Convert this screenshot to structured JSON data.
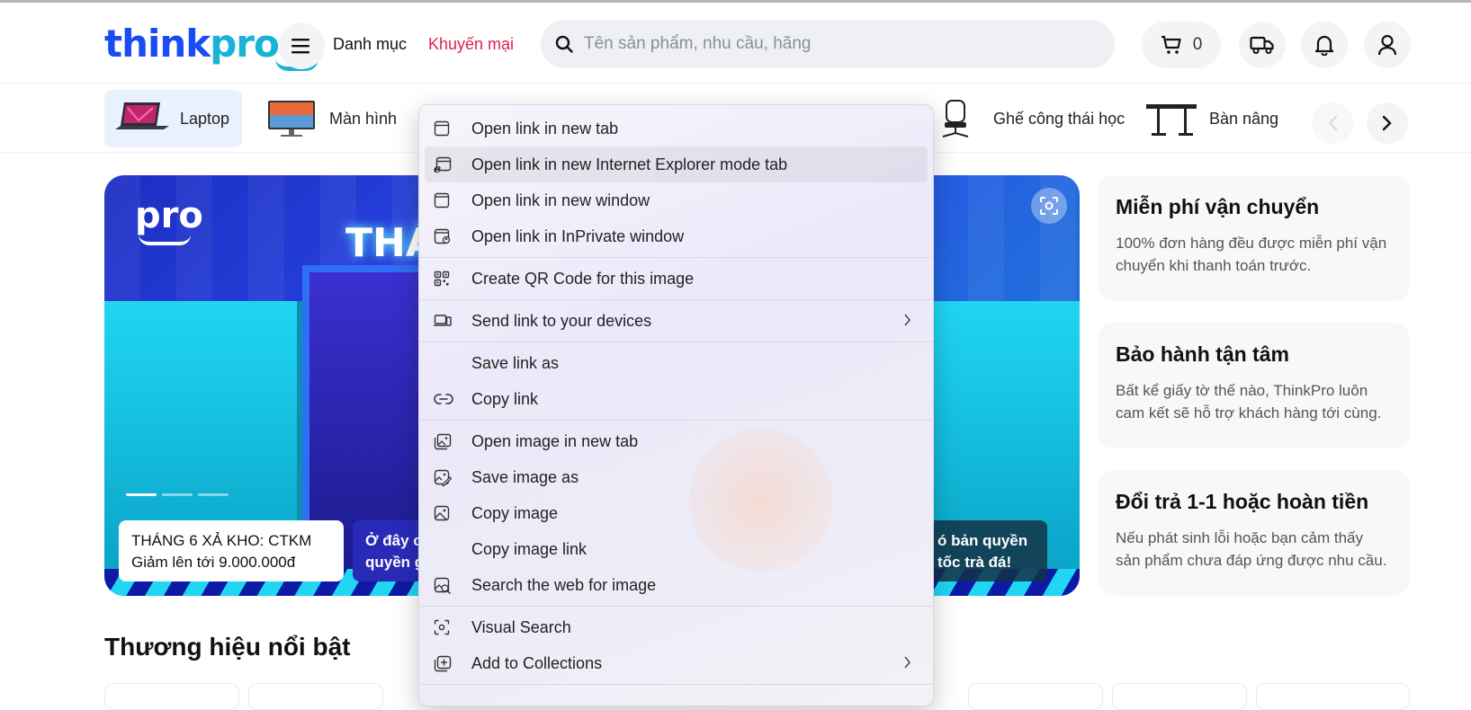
{
  "header": {
    "logo_part1": "think",
    "logo_part2": "pro",
    "menu_label": "Danh mục",
    "promo_label": "Khuyến mại",
    "search_placeholder": "Tên sản phẩm, nhu cầu, hãng",
    "cart_count": "0"
  },
  "categories": [
    {
      "label": "Laptop",
      "active": true
    },
    {
      "label": "Màn hình",
      "active": false
    },
    {
      "label": "Ghế công thái học",
      "active": false
    },
    {
      "label": "Bàn nâng",
      "active": false
    }
  ],
  "banner": {
    "logo": "pro",
    "headline": "THÁ",
    "captions": [
      {
        "line1": "THÁNG 6 XẢ KHO: CTKM",
        "line2": "Giảm lên tới 9.000.000đ"
      },
      {
        "line1": "Ở đây c",
        "line2": "quyền g"
      },
      {
        "line1": "ó bản quyền",
        "line2": "tốc trà đá!"
      }
    ]
  },
  "promos": [
    {
      "title": "Miễn phí vận chuyển",
      "text": "100% đơn hàng đều được miễn phí vận chuyển khi thanh toán trước."
    },
    {
      "title": "Bảo hành tận tâm",
      "text": "Bất kể giấy tờ thế nào, ThinkPro luôn cam kết sẽ hỗ trợ khách hàng tới cùng."
    },
    {
      "title": "Đổi trả 1-1 hoặc hoàn tiền",
      "text": "Nếu phát sinh lỗi hoặc bạn cảm thấy sản phẩm chưa đáp ứng được nhu cầu."
    }
  ],
  "brands_title": "Thương hiệu nổi bật",
  "context_menu": {
    "items": [
      {
        "label": "Open link in new tab",
        "icon": "new-tab-icon"
      },
      {
        "label": "Open link in new Internet Explorer mode tab",
        "icon": "ie-icon"
      },
      {
        "label": "Open link in new window",
        "icon": "window-icon"
      },
      {
        "label": "Open link in InPrivate window",
        "icon": "inprivate-icon"
      },
      {
        "label": "Create QR Code for this image",
        "icon": "qr-icon"
      },
      {
        "label": "Send link to your devices",
        "icon": "devices-icon"
      },
      {
        "label": "Save link as",
        "icon": ""
      },
      {
        "label": "Copy link",
        "icon": "link-icon"
      },
      {
        "label": "Open image in new tab",
        "icon": "image-tab-icon"
      },
      {
        "label": "Save image as",
        "icon": "save-image-icon"
      },
      {
        "label": "Copy image",
        "icon": "image-icon"
      },
      {
        "label": "Copy image link",
        "icon": ""
      },
      {
        "label": "Search the web for image",
        "icon": "image-search-icon"
      },
      {
        "label": "Visual Search",
        "icon": "visual-search-icon"
      },
      {
        "label": "Add to Collections",
        "icon": "collections-icon"
      }
    ]
  }
}
